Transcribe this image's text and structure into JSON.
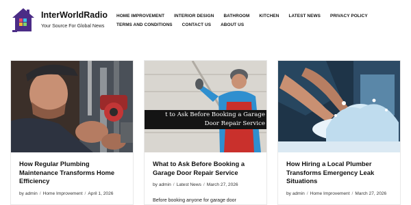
{
  "site": {
    "title": "InterWorldRadio",
    "tagline": "Your Source For Global News"
  },
  "nav": {
    "row1": [
      "HOME IMPROVEMENT",
      "INTERIOR DESIGN",
      "BATHROOM",
      "KITCHEN",
      "LATEST NEWS",
      "PRIVACY POLICY"
    ],
    "row2": [
      "TERMS AND CONDITIONS",
      "CONTACT US",
      "ABOUT US"
    ]
  },
  "posts": [
    {
      "title": "How Regular Plumbing Maintenance Transforms Home Efficiency",
      "author": "admin",
      "category": "Home Improvement",
      "date": "April 1, 2026"
    },
    {
      "title": "What to Ask Before Booking a Garage Door Repair Service",
      "author": "admin",
      "category": "Latest News",
      "date": "March 27, 2026",
      "excerpt": "Before booking anyone for garage door",
      "image_overlay_line1": "t to Ask Before Booking a Garage",
      "image_overlay_line2": "Door Repair Service"
    },
    {
      "title": "How Hiring a Local Plumber Transforms Emergency Leak Situations",
      "author": "admin",
      "category": "Home Improvement",
      "date": "March 27, 2026"
    }
  ],
  "meta_prefix": "by",
  "meta_separator": "/",
  "colors": {
    "logo_purple": "#4b2c86",
    "text": "#111111",
    "card_border": "#e8e8e8",
    "overlay_bg": "#141414"
  }
}
